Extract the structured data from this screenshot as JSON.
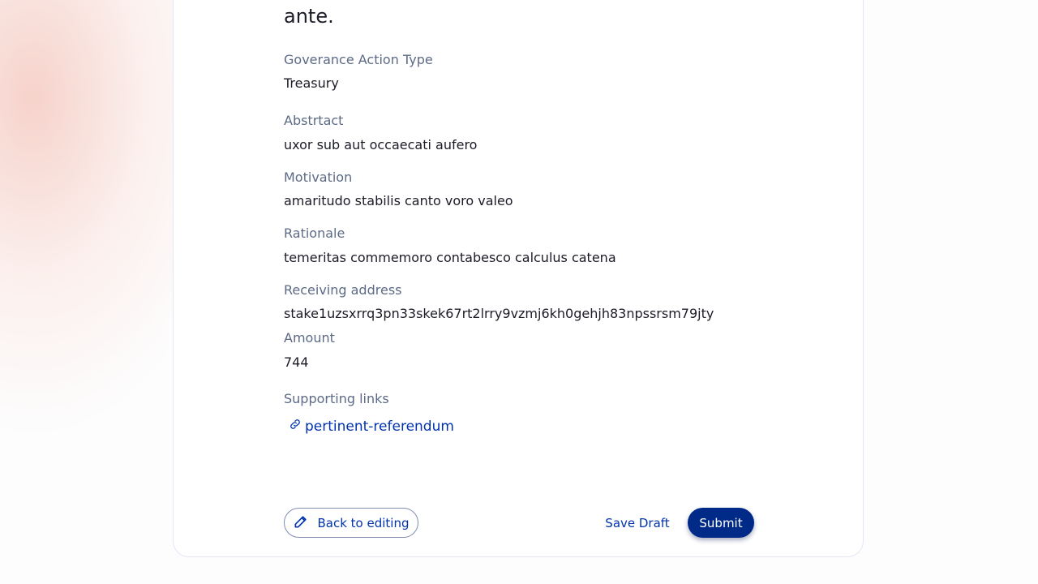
{
  "proposal": {
    "title_fragment": "ante.",
    "fields": [
      {
        "label": "Goverance Action Type",
        "value": "Treasury"
      },
      {
        "label": "Abstrtact",
        "value": "uxor sub aut occaecati aufero"
      },
      {
        "label": "Motivation",
        "value": "amaritudo stabilis canto voro valeo"
      },
      {
        "label": "Rationale",
        "value": "temeritas commemoro contabesco calculus catena"
      },
      {
        "label": "Receiving address",
        "value": "stake1uzsxrrq3pn33skek67rt2lrry9vzmj6kh0gehjh83npssrsm79jty"
      },
      {
        "label": "Amount",
        "value": "744"
      }
    ],
    "supporting_links_label": "Supporting links",
    "links": [
      "pertinent-referendum"
    ]
  },
  "actions": {
    "back_label": "Back to editing",
    "draft_label": "Save Draft",
    "submit_label": "Submit"
  },
  "colors": {
    "accent": "#0033ad",
    "submit_bg": "#002a87",
    "label": "#5c6a86",
    "text": "#1c1c28"
  },
  "icons": {
    "link": "link-icon",
    "back": "pencil-icon"
  }
}
